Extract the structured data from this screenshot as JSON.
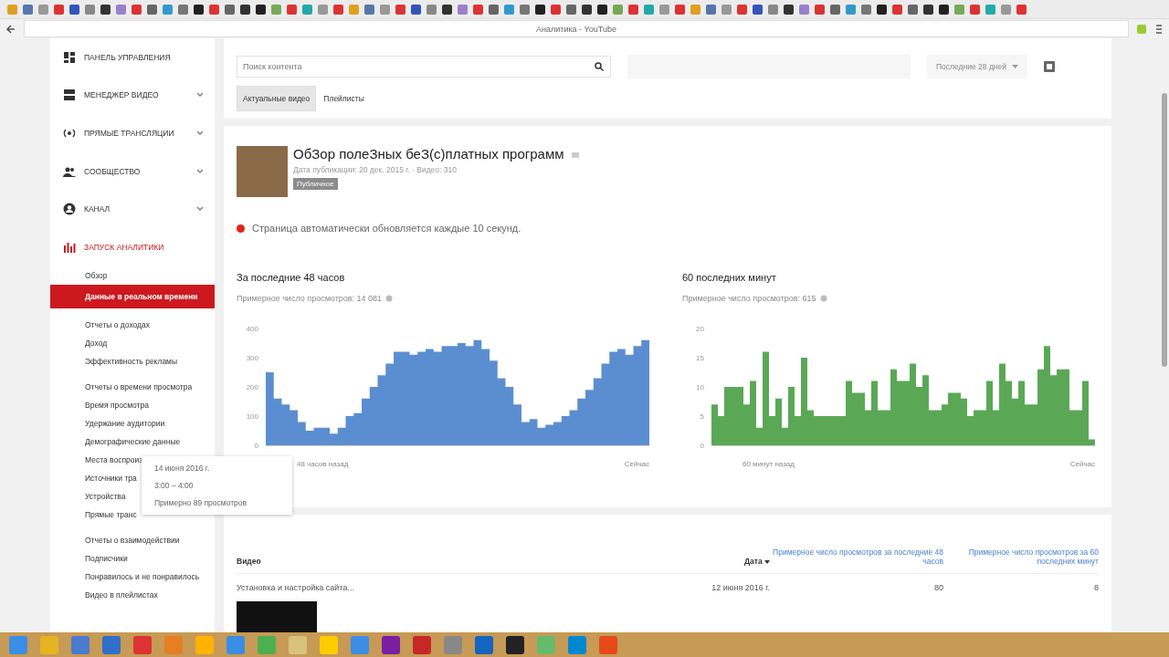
{
  "browser": {
    "tab_title": "Аналитика - YouTube"
  },
  "sidebar": {
    "items": [
      {
        "label": "ПАНЕЛЬ УПРАВЛЕНИЯ",
        "collapsible": false,
        "selected": false
      },
      {
        "label": "МЕНЕДЖЕР ВИДЕО",
        "collapsible": true,
        "selected": false
      },
      {
        "label": "ПРЯМЫЕ ТРАНСЛЯЦИИ",
        "collapsible": true,
        "selected": false
      },
      {
        "label": "СООБЩЕСТВО",
        "collapsible": true,
        "selected": false
      },
      {
        "label": "КАНАЛ",
        "collapsible": true,
        "selected": false
      },
      {
        "label": "ЗАПУСК АНАЛИТИКИ",
        "collapsible": false,
        "selected": true,
        "groups": [
          {
            "items": [
              {
                "label": "Обзор",
                "selected": false
              },
              {
                "label": "Данные в реальном времени",
                "selected": true
              }
            ]
          },
          {
            "items": [
              {
                "label": "Отчеты о доходах",
                "selected": false
              },
              {
                "label": "Доход",
                "selected": false
              },
              {
                "label": "Эффективность рекламы",
                "selected": false
              }
            ]
          },
          {
            "items": [
              {
                "label": "Отчеты о времени просмотра",
                "selected": false
              },
              {
                "label": "Время просмотра",
                "selected": false
              },
              {
                "label": "Удержание аудитории",
                "selected": false
              },
              {
                "label": "Демографические данные",
                "selected": false
              },
              {
                "label": "Места воспроиз",
                "selected": false
              },
              {
                "label": "Источники тра",
                "selected": false
              },
              {
                "label": "Устройства",
                "selected": false
              },
              {
                "label": "Прямые транс",
                "selected": false
              }
            ]
          },
          {
            "items": [
              {
                "label": "Отчеты о взаимодействии",
                "selected": false
              },
              {
                "label": "Подписчики",
                "selected": false
              },
              {
                "label": "Понравилось и не понравилось",
                "selected": false
              },
              {
                "label": "Видео в плейлистах",
                "selected": false
              }
            ]
          }
        ]
      }
    ]
  },
  "toolbar": {
    "search": {
      "placeholder": "Поиск контента"
    },
    "period": "Последние 28 дней",
    "tabs": [
      {
        "label": "Актуальные видео",
        "selected": true
      },
      {
        "label": "Плейлисты",
        "selected": false
      }
    ]
  },
  "video": {
    "title": "ОбЗор полеЗных беЗ(с)платных программ",
    "meta": "Дата публикации: 20 дек. 2015 г. · Видео: 310",
    "badge": "Публичное"
  },
  "live_notice": {
    "text": "Страница автоматически обновляется каждые 10 секунд.",
    "color": "#e62117"
  },
  "panels": [
    {
      "title": "За последние 48 часов",
      "subtitle": "Примерное число просмотров: 14 081",
      "x_start": "48 часов назад",
      "x_end": "Сейчас",
      "y_ticks": [
        "400",
        "300",
        "200",
        "100",
        "0"
      ],
      "color": "#5b8ed0"
    },
    {
      "title": "60 последних минут",
      "subtitle": "Примерное число просмотров: 615",
      "x_start": "60 минут назад",
      "x_end": "Сейчас",
      "y_ticks": [
        "20",
        "15",
        "10",
        "5",
        "0"
      ],
      "color": "#5aa856"
    }
  ],
  "tooltip": {
    "date": "14 июня 2016 г.",
    "time": "3:00 – 4:00",
    "views": "Примерно 89 просмотров"
  },
  "table": {
    "columns": [
      {
        "label": "Видео",
        "sorted": false
      },
      {
        "label": "Дата",
        "sorted": true
      },
      {
        "label": "Примерное число просмотров за последние 48 часов",
        "sorted": false
      },
      {
        "label": "Примерное число просмотров за 60 последних минут",
        "sorted": false
      }
    ],
    "rows": [
      {
        "cells": [
          "Установка и настройка сайта...",
          "12 июня 2016 г.",
          "80",
          "8"
        ]
      }
    ]
  }
}
